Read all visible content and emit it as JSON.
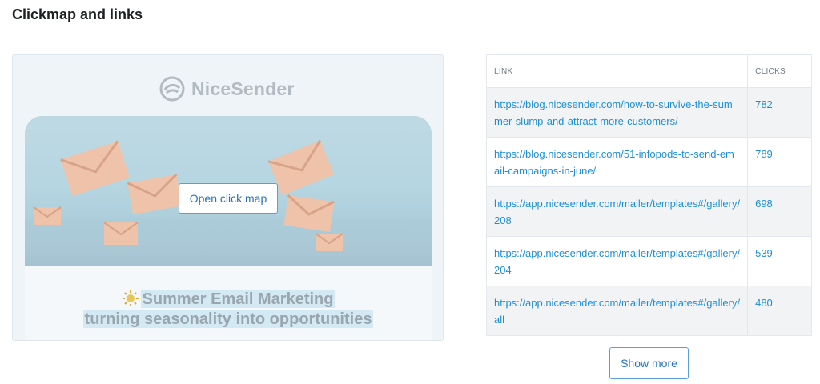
{
  "page": {
    "title": "Clickmap and links"
  },
  "preview": {
    "brand": "NiceSender",
    "open_button": "Open click map",
    "headline_line1": "Summer Email Marketing",
    "headline_line2": "turning seasonality into opportunities"
  },
  "table": {
    "headers": {
      "link": "LINK",
      "clicks": "CLICKS"
    },
    "rows": [
      {
        "url": "https://blog.nicesender.com/how-to-survive-the-summer-slump-and-attract-more-customers/",
        "clicks": "782"
      },
      {
        "url": "https://blog.nicesender.com/51-infopods-to-send-email-campaigns-in-june/",
        "clicks": "789"
      },
      {
        "url": "https://app.nicesender.com/mailer/templates#/gallery/208",
        "clicks": "698"
      },
      {
        "url": "https://app.nicesender.com/mailer/templates#/gallery/204",
        "clicks": "539"
      },
      {
        "url": "https://app.nicesender.com/mailer/templates#/gallery/all",
        "clicks": "480"
      }
    ]
  },
  "show_more": "Show more",
  "colors": {
    "accent": "#1e8fd6",
    "button_border": "#5aa0d8"
  }
}
